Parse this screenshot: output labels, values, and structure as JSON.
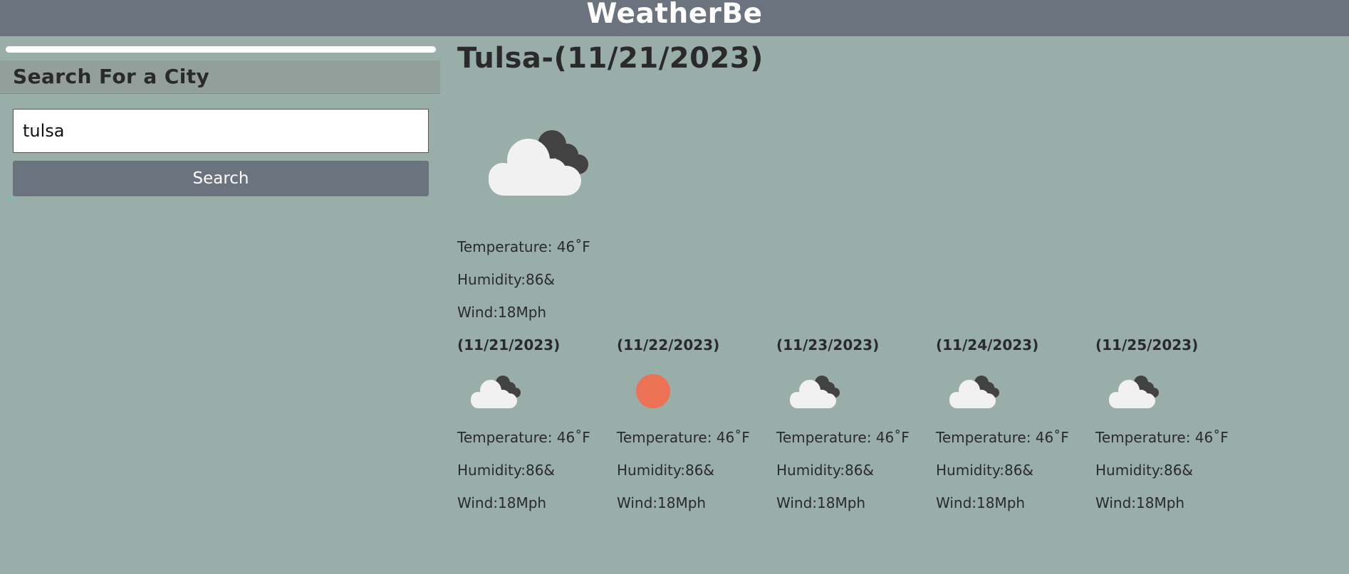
{
  "header": {
    "title": "WeatherBe"
  },
  "sidebar": {
    "heading": "Search For a City",
    "search_value": "tulsa",
    "search_button": "Search"
  },
  "current": {
    "title": "Tulsa-(11/21/2023)",
    "icon": "cloudy-icon",
    "temperature": "Temperature: 46˚F",
    "humidity": "Humidity:86&",
    "wind": "Wind:18Mph"
  },
  "forecast": [
    {
      "date": "(11/21/2023)",
      "icon": "cloudy-icon",
      "temperature": "Temperature: 46˚F",
      "humidity": "Humidity:86&",
      "wind": "Wind:18Mph"
    },
    {
      "date": "(11/22/2023)",
      "icon": "sun-icon",
      "temperature": "Temperature: 46˚F",
      "humidity": "Humidity:86&",
      "wind": "Wind:18Mph"
    },
    {
      "date": "(11/23/2023)",
      "icon": "cloudy-icon",
      "temperature": "Temperature: 46˚F",
      "humidity": "Humidity:86&",
      "wind": "Wind:18Mph"
    },
    {
      "date": "(11/24/2023)",
      "icon": "cloudy-icon",
      "temperature": "Temperature: 46˚F",
      "humidity": "Humidity:86&",
      "wind": "Wind:18Mph"
    },
    {
      "date": "(11/25/2023)",
      "icon": "cloudy-icon",
      "temperature": "Temperature: 46˚F",
      "humidity": "Humidity:86&",
      "wind": "Wind:18Mph"
    }
  ],
  "colors": {
    "background": "#99aea9",
    "header": "#6b737e",
    "sun": "#ec7155",
    "cloud_light": "#f1f1f1",
    "cloud_dark": "#424242"
  }
}
